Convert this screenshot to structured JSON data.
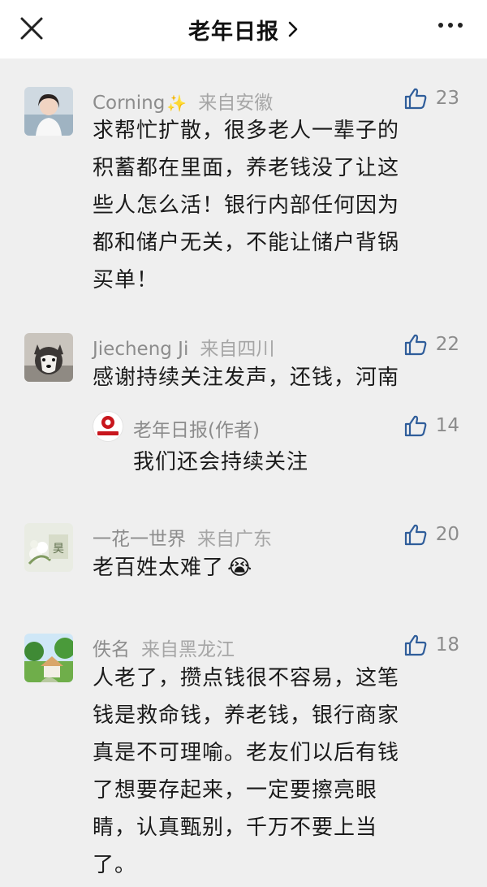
{
  "header": {
    "title": "老年日报",
    "chevron": "›",
    "close_icon": "close-icon",
    "more_icon": "more-icon"
  },
  "comments": [
    {
      "user": "Corning",
      "user_badge": "✨",
      "location": "来自安徽",
      "likes": "23",
      "lines": [
        "求帮忙扩散，很多老人一辈子的",
        "积蓄都在里面，养老钱没了让这",
        "些人怎么活！银行内部任何因为",
        "都和储户无关，不能让储户背锅",
        "买单！"
      ]
    },
    {
      "user": "Jiecheng Ji",
      "location": "来自四川",
      "likes": "22",
      "lines": [
        "感谢持续关注发声，还钱，河南"
      ],
      "reply": {
        "user": "老年日报(作者)",
        "avatar_text": "老年日报",
        "likes": "14",
        "text": "我们还会持续关注"
      }
    },
    {
      "user": "一花一世界",
      "location": "来自广东",
      "likes": "20",
      "lines": [
        "老百姓太难了"
      ],
      "emoji": "😭"
    },
    {
      "user": "佚名",
      "location": "来自黑龙江",
      "likes": "18",
      "lines": [
        "人老了，攒点钱很不容易，这笔",
        "钱是救命钱，养老钱，银行商家",
        "真是不可理喻。老友们以后有钱",
        "了想要存起来，一定要擦亮眼",
        "睛，认真甄别，千万不要上当",
        "了。"
      ]
    }
  ],
  "colors": {
    "background": "#efefef",
    "header_bg": "#ffffff",
    "meta_text": "#8c8c8c",
    "like_icon": "#2f5d9a",
    "brand_red": "#c8161d"
  }
}
